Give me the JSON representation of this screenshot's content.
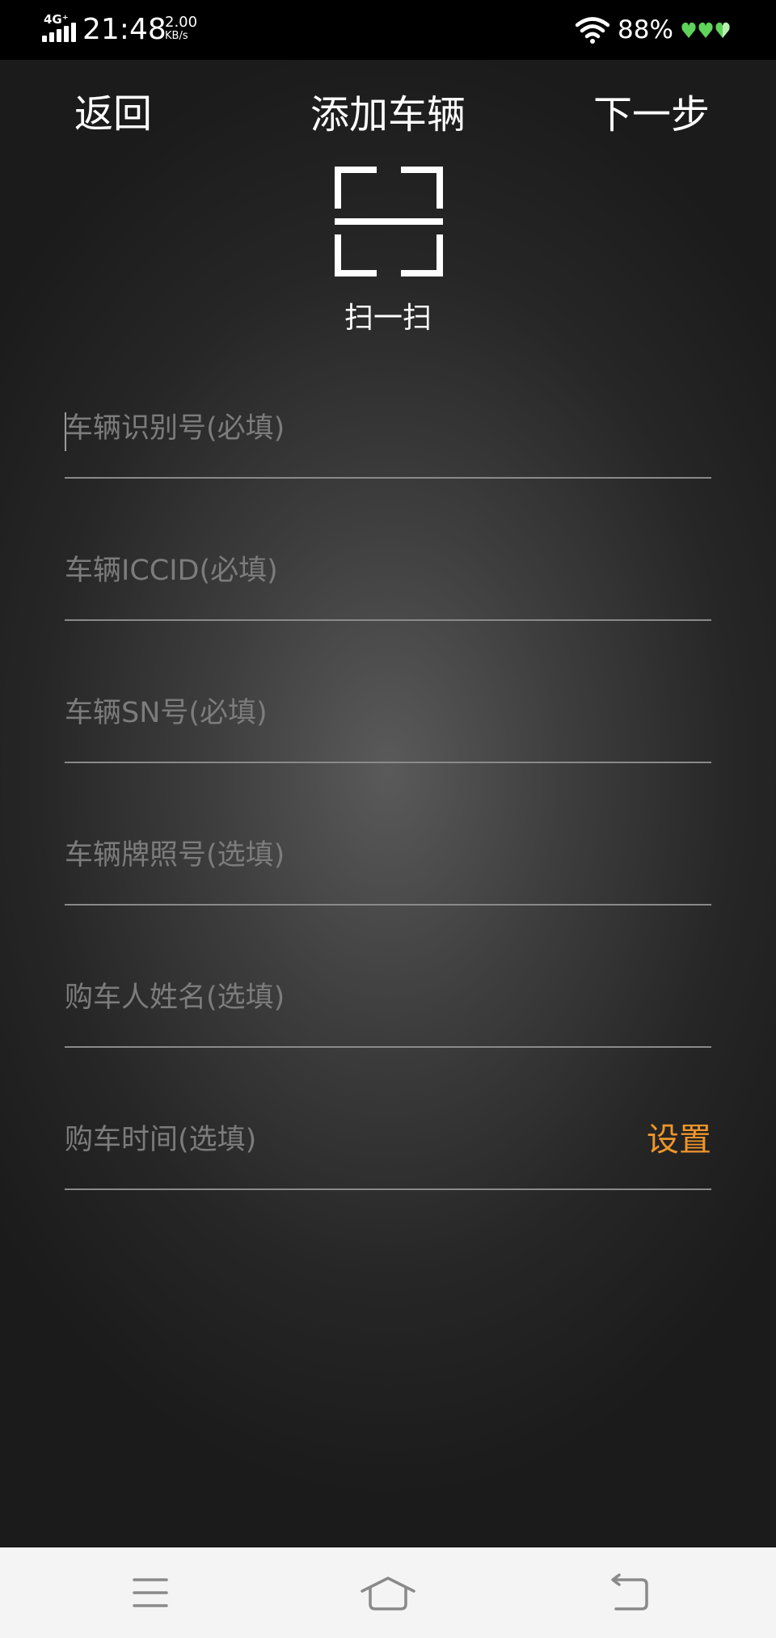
{
  "status_bar": {
    "network": "4G⁺",
    "time": "21:48",
    "speed_value": "2.00",
    "speed_unit": "KB/s",
    "battery_percent": "88%",
    "icons": [
      "signal-icon",
      "wifi-icon",
      "battery-icon"
    ]
  },
  "header": {
    "back_label": "返回",
    "title": "添加车辆",
    "next_label": "下一步"
  },
  "scan": {
    "label": "扫一扫",
    "icon": "scan-icon"
  },
  "form": {
    "fields": [
      {
        "placeholder": "车辆识别号(必填)",
        "value": ""
      },
      {
        "placeholder": "车辆ICCID(必填)",
        "value": ""
      },
      {
        "placeholder": "车辆SN号(必填)",
        "value": ""
      },
      {
        "placeholder": "车辆牌照号(选填)",
        "value": ""
      },
      {
        "placeholder": "购车人姓名(选填)",
        "value": ""
      },
      {
        "placeholder": "购车时间(选填)",
        "value": ""
      }
    ],
    "purchase_time_action": "设置"
  },
  "colors": {
    "accent": "#f0952a",
    "status_bar_bg": "#000000",
    "divider": "#8a8a8a",
    "placeholder": "#7c7c7c",
    "bottom_nav_bg": "#f4f4f4",
    "battery_hearts": "#5fd35a"
  },
  "bottom_nav": {
    "icons": [
      "menu-icon",
      "home-icon",
      "back-icon"
    ]
  }
}
